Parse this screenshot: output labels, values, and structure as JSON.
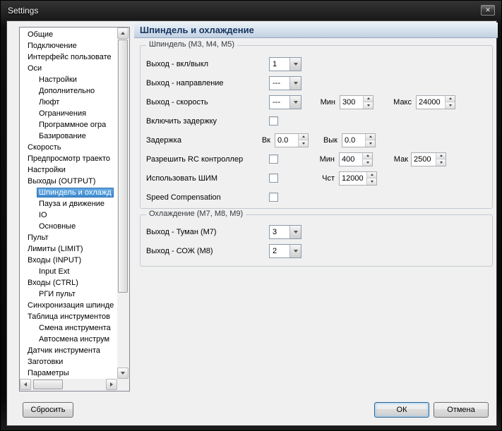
{
  "window": {
    "title": "Settings"
  },
  "icons": {
    "close": "✕"
  },
  "colors": {
    "selection_blue": "#3e8bd0",
    "header_band_bg": "#c2d1e3",
    "header_band_text": "#16355e",
    "client_bg": "#f0f0f0"
  },
  "tree": {
    "items": [
      {
        "label": "Общие",
        "level": 0,
        "selected": false
      },
      {
        "label": "Подключение",
        "level": 0,
        "selected": false
      },
      {
        "label": "Интерфейс пользовате",
        "level": 0,
        "selected": false
      },
      {
        "label": "Оси",
        "level": 0,
        "selected": false
      },
      {
        "label": "Настройки",
        "level": 1,
        "selected": false
      },
      {
        "label": "Дополнительно",
        "level": 1,
        "selected": false
      },
      {
        "label": "Люфт",
        "level": 1,
        "selected": false
      },
      {
        "label": "Ограничения",
        "level": 1,
        "selected": false
      },
      {
        "label": "Программное огра",
        "level": 1,
        "selected": false
      },
      {
        "label": "Базирование",
        "level": 1,
        "selected": false
      },
      {
        "label": "Скорость",
        "level": 0,
        "selected": false
      },
      {
        "label": "Предпросмотр траекто",
        "level": 0,
        "selected": false
      },
      {
        "label": "Настройки",
        "level": 0,
        "selected": false
      },
      {
        "label": "Выходы (OUTPUT)",
        "level": 0,
        "selected": false
      },
      {
        "label": "Шпиндель и охлажд",
        "level": 1,
        "selected": true
      },
      {
        "label": "Пауза и движение",
        "level": 1,
        "selected": false
      },
      {
        "label": "IO",
        "level": 1,
        "selected": false
      },
      {
        "label": "Основные",
        "level": 1,
        "selected": false
      },
      {
        "label": "Пульт",
        "level": 0,
        "selected": false
      },
      {
        "label": "Лимиты (LIMIT)",
        "level": 0,
        "selected": false
      },
      {
        "label": "Входы (INPUT)",
        "level": 0,
        "selected": false
      },
      {
        "label": "Input Ext",
        "level": 1,
        "selected": false
      },
      {
        "label": "Входы (CTRL)",
        "level": 0,
        "selected": false
      },
      {
        "label": "РГИ пульт",
        "level": 1,
        "selected": false
      },
      {
        "label": "Синхронизация шпинде",
        "level": 0,
        "selected": false
      },
      {
        "label": "Таблица инструментов",
        "level": 0,
        "selected": false
      },
      {
        "label": "Смена инструмента",
        "level": 1,
        "selected": false
      },
      {
        "label": "Автосмена инструм",
        "level": 1,
        "selected": false
      },
      {
        "label": "Датчик инструмента",
        "level": 0,
        "selected": false
      },
      {
        "label": "Заготовки",
        "level": 0,
        "selected": false
      },
      {
        "label": "Параметры",
        "level": 0,
        "selected": false
      }
    ]
  },
  "panel": {
    "header": "Шпиндель и охлаждение",
    "spindle": {
      "title": "Шпиндель (M3, M4, M5)",
      "row_onoff": {
        "label": "Выход - вкл/выкл",
        "value": "1"
      },
      "row_direction": {
        "label": "Выход - направление",
        "value": "---"
      },
      "row_speed": {
        "label": "Выход - скорость",
        "value": "---",
        "min_label": "Мин",
        "min_value": "300",
        "max_label": "Макс",
        "max_value": "24000"
      },
      "row_delay_enable": {
        "label": "Включить задержку",
        "checked": false
      },
      "row_delay": {
        "label": "Задержка",
        "on_label": "Вк",
        "on_value": "0.0",
        "off_label": "Вык",
        "off_value": "0.0"
      },
      "row_rc": {
        "label": "Разрешить RC контроллер",
        "checked": false,
        "min_label": "Мин",
        "min_value": "400",
        "max_label": "Мак",
        "max_value": "2500"
      },
      "row_pwm": {
        "label": "Использовать ШИМ",
        "checked": false,
        "freq_label": "Чст",
        "freq_value": "12000"
      },
      "row_speedcomp": {
        "label": "Speed Compensation",
        "checked": false
      }
    },
    "cooling": {
      "title": "Охлаждение (M7, M8, M9)",
      "row_mist": {
        "label": "Выход - Туман (M7)",
        "value": "3"
      },
      "row_flood": {
        "label": "Выход - СОЖ (M8)",
        "value": "2"
      }
    }
  },
  "buttons": {
    "reset": "Сбросить",
    "ok": "ОК",
    "cancel": "Отмена"
  }
}
